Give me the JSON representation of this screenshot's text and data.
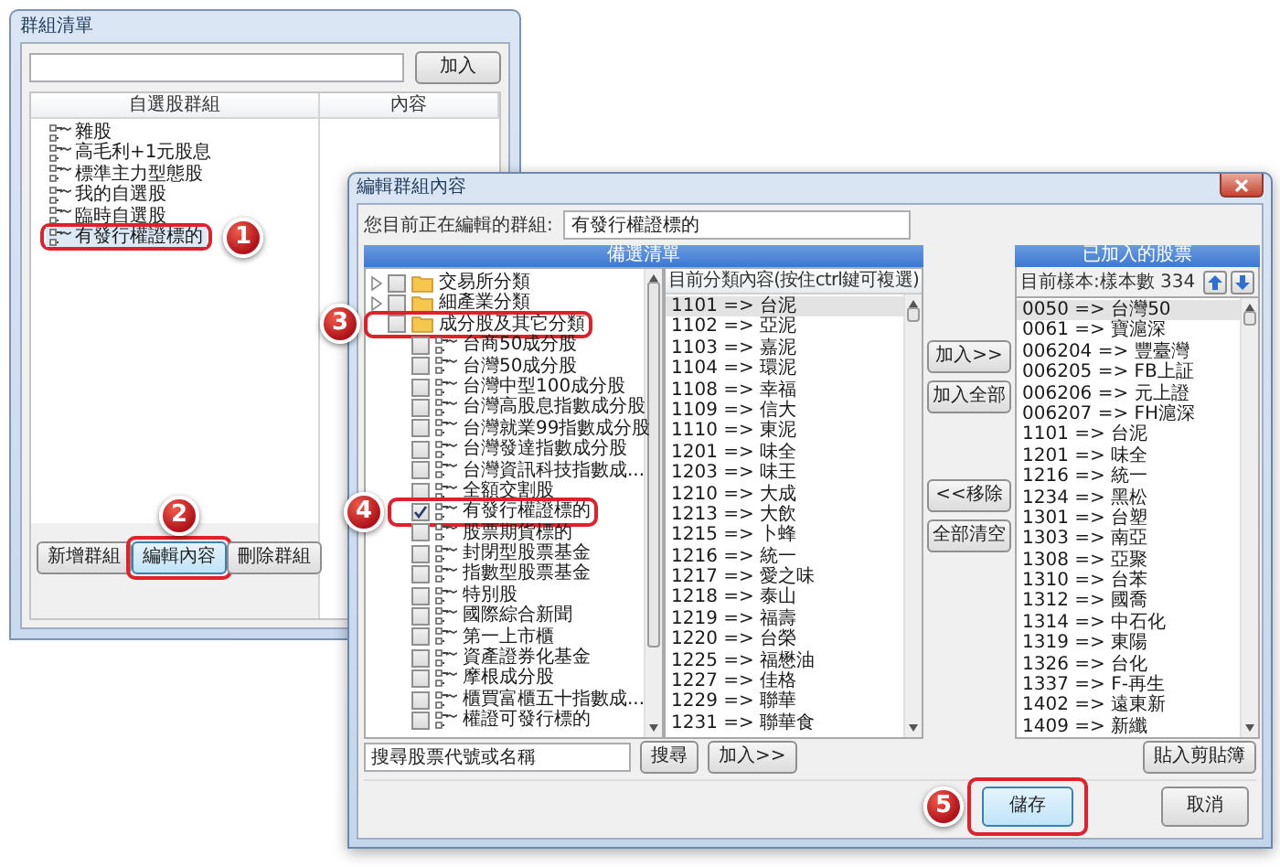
{
  "group_window": {
    "title": "群組清單",
    "add_button": "加入",
    "columns": [
      "自選股群組",
      "內容"
    ],
    "groups": [
      {
        "label": "雜股",
        "selected": false
      },
      {
        "label": "高毛利+1元股息",
        "selected": false
      },
      {
        "label": "標準主力型態股",
        "selected": false
      },
      {
        "label": "我的自選股",
        "selected": false
      },
      {
        "label": "臨時自選股",
        "selected": false
      },
      {
        "label": "有發行權證標的",
        "selected": true,
        "callout": "1"
      }
    ],
    "buttons": [
      {
        "label": "新增群組",
        "selected": false
      },
      {
        "label": "編輯內容",
        "selected": true,
        "callout": "2"
      },
      {
        "label": "刪除群組",
        "selected": false
      }
    ]
  },
  "edit_dialog": {
    "title": "編輯群組內容",
    "group_label": "您目前正在編輯的群組:",
    "group_value": "有發行權證標的",
    "source_title": "備選清單",
    "categories": [
      {
        "kind": "folder",
        "label": "交易所分類",
        "checked": false,
        "expanded": false
      },
      {
        "kind": "folder",
        "label": "細產業分類",
        "checked": false,
        "expanded": false
      },
      {
        "kind": "folder",
        "label": "成分股及其它分類",
        "checked": false,
        "expanded": true,
        "callout": "3",
        "children": [
          {
            "kind": "group",
            "label": "台商50成分股",
            "checked": false
          },
          {
            "kind": "group",
            "label": "台灣50成分股",
            "checked": false
          },
          {
            "kind": "group",
            "label": "台灣中型100成分股",
            "checked": false
          },
          {
            "kind": "group",
            "label": "台灣高股息指數成分股",
            "checked": false
          },
          {
            "kind": "group",
            "label": "台灣就業99指數成分股",
            "checked": false
          },
          {
            "kind": "group",
            "label": "台灣發達指數成分股",
            "checked": false
          },
          {
            "kind": "group",
            "label": "台灣資訊科技指數成...",
            "checked": false
          },
          {
            "kind": "group",
            "label": "全額交割股",
            "checked": false
          },
          {
            "kind": "group",
            "label": "有發行權證標的",
            "checked": true,
            "callout": "4"
          },
          {
            "kind": "group",
            "label": "股票期貨標的",
            "checked": false
          },
          {
            "kind": "group",
            "label": "封閉型股票基金",
            "checked": false
          },
          {
            "kind": "group",
            "label": "指數型股票基金",
            "checked": false
          },
          {
            "kind": "group",
            "label": "特別股",
            "checked": false
          },
          {
            "kind": "group",
            "label": "國際綜合新聞",
            "checked": false
          },
          {
            "kind": "group",
            "label": "第一上市櫃",
            "checked": false
          },
          {
            "kind": "group",
            "label": "資產證券化基金",
            "checked": false
          },
          {
            "kind": "group",
            "label": "摩根成分股",
            "checked": false
          },
          {
            "kind": "group",
            "label": "櫃買富櫃五十指數成...",
            "checked": false
          },
          {
            "kind": "group",
            "label": "權證可發行標的",
            "checked": false
          }
        ]
      }
    ],
    "list_header": "目前分類內容(按住ctrl鍵可複選)",
    "list_items": [
      {
        "label": "1101 => 台泥",
        "selected": true
      },
      {
        "label": "1102 => 亞泥",
        "selected": false
      },
      {
        "label": "1103 => 嘉泥",
        "selected": false
      },
      {
        "label": "1104 => 環泥",
        "selected": false
      },
      {
        "label": "1108 => 幸福",
        "selected": false
      },
      {
        "label": "1109 => 信大",
        "selected": false
      },
      {
        "label": "1110 => 東泥",
        "selected": false
      },
      {
        "label": "1201 => 味全",
        "selected": false
      },
      {
        "label": "1203 => 味王",
        "selected": false
      },
      {
        "label": "1210 => 大成",
        "selected": false
      },
      {
        "label": "1213 => 大飲",
        "selected": false
      },
      {
        "label": "1215 => 卜蜂",
        "selected": false
      },
      {
        "label": "1216 => 統一",
        "selected": false
      },
      {
        "label": "1217 => 愛之味",
        "selected": false
      },
      {
        "label": "1218 => 泰山",
        "selected": false
      },
      {
        "label": "1219 => 福壽",
        "selected": false
      },
      {
        "label": "1220 => 台榮",
        "selected": false
      },
      {
        "label": "1225 => 福懋油",
        "selected": false
      },
      {
        "label": "1227 => 佳格",
        "selected": false
      },
      {
        "label": "1229 => 聯華",
        "selected": false
      },
      {
        "label": "1231 => 聯華食",
        "selected": false
      }
    ],
    "move_buttons": [
      "加入>>",
      "加入全部"
    ],
    "remove_buttons": [
      "<<移除",
      "全部清空"
    ],
    "added_title": "已加入的股票",
    "sample_count": "目前樣本:樣本數 334",
    "added_items": [
      {
        "label": "0050 => 台灣50",
        "selected": true
      },
      {
        "label": "0061 => 寶滬深",
        "selected": false
      },
      {
        "label": "006204 => 豐臺灣",
        "selected": false
      },
      {
        "label": "006205 => FB上証",
        "selected": false
      },
      {
        "label": "006206 => 元上證",
        "selected": false
      },
      {
        "label": "006207 => FH滬深",
        "selected": false
      },
      {
        "label": "1101 => 台泥",
        "selected": false
      },
      {
        "label": "1201 => 味全",
        "selected": false
      },
      {
        "label": "1216 => 統一",
        "selected": false
      },
      {
        "label": "1234 => 黑松",
        "selected": false
      },
      {
        "label": "1301 => 台塑",
        "selected": false
      },
      {
        "label": "1303 => 南亞",
        "selected": false
      },
      {
        "label": "1308 => 亞聚",
        "selected": false
      },
      {
        "label": "1310 => 台苯",
        "selected": false
      },
      {
        "label": "1312 => 國喬",
        "selected": false
      },
      {
        "label": "1314 => 中石化",
        "selected": false
      },
      {
        "label": "1319 => 東陽",
        "selected": false
      },
      {
        "label": "1326 => 台化",
        "selected": false
      },
      {
        "label": "1337 => F-再生",
        "selected": false
      },
      {
        "label": "1402 => 遠東新",
        "selected": false
      },
      {
        "label": "1409 => 新纖",
        "selected": false
      }
    ],
    "search_placeholder": "搜尋股票代號或名稱",
    "search_button": "搜尋",
    "search_add_button": "加入>>",
    "paste_button": "貼入剪貼簿",
    "save_button": {
      "label": "儲存",
      "callout": "5"
    },
    "cancel_button": "取消"
  }
}
